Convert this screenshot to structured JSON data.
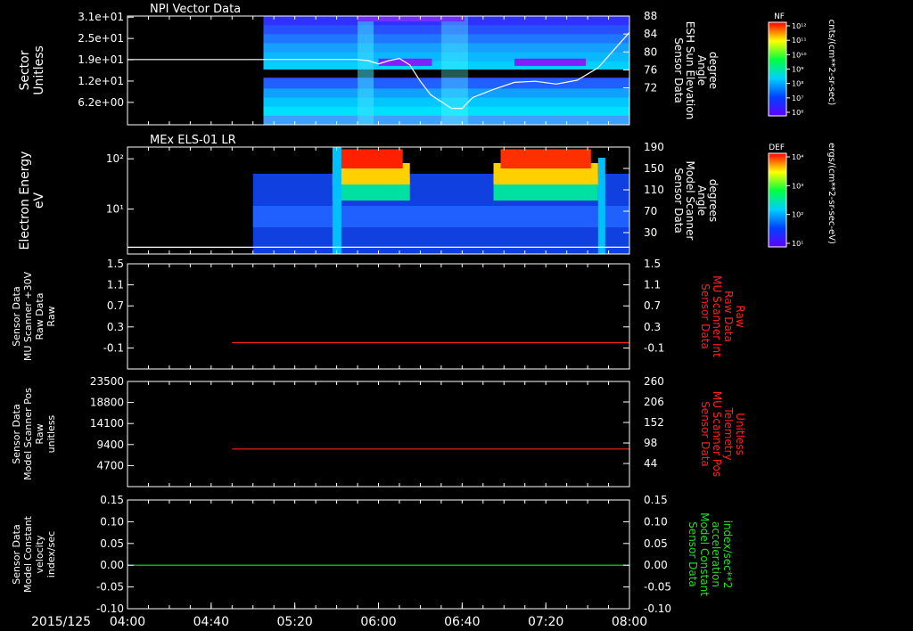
{
  "chart_data": [
    {
      "type": "heatmap",
      "title": "NPI Vector Data",
      "ylabel_lines": [
        "Sector",
        "Unitless"
      ],
      "yticks": [
        "3.1e+01",
        "2.5e+01",
        "1.9e+01",
        "1.2e+01",
        "6.2e+00"
      ],
      "y2label_lines": [
        "Sensor Data",
        "ESH Sun Elevation",
        "Angle",
        "degree"
      ],
      "y2ticks": [
        "88",
        "84",
        "80",
        "76",
        "72"
      ],
      "colorbar_label": "NF",
      "colorbar_units": "cnts/(cm**2-sr-sec)",
      "colorbar_ticks": [
        "10¹²",
        "10¹¹",
        "10¹⁰",
        "10⁹",
        "10⁸",
        "10⁷",
        "10⁶"
      ],
      "overlay_series": {
        "name": "ESH Sun Elevation Angle",
        "color": "#ffffff",
        "x": [
          "04:00",
          "05:20",
          "05:50",
          "05:55",
          "06:00",
          "06:05",
          "06:10",
          "06:15",
          "06:20",
          "06:25",
          "06:35",
          "06:40",
          "06:45",
          "06:55",
          "07:05",
          "07:15",
          "07:25",
          "07:35",
          "07:45",
          "08:00"
        ],
        "y": [
          80.0,
          80.0,
          80.0,
          79.8,
          79.2,
          79.8,
          80.2,
          79.0,
          76.0,
          73.5,
          71.0,
          71.0,
          73.0,
          74.5,
          75.8,
          76.0,
          75.5,
          76.2,
          78.5,
          85.0
        ]
      }
    },
    {
      "type": "heatmap",
      "title": "MEx ELS-01 LR",
      "ylabel_lines": [
        "Electron Energy",
        "eV"
      ],
      "yticks": [
        "10²",
        "10¹"
      ],
      "y2label_lines": [
        "Sensor Data",
        "Model Scanner",
        "Angle",
        "degrees"
      ],
      "y2ticks": [
        "190",
        "150",
        "110",
        "70",
        "30"
      ],
      "colorbar_label": "DEF",
      "colorbar_units": "ergs/(cm**2-sr-sec-eV)",
      "colorbar_ticks": [
        "10⁴",
        "10³",
        "10²",
        "10¹"
      ],
      "overlay_series": {
        "name": "Model Scanner Angle",
        "color": "#ffffff",
        "x": [
          "04:00",
          "08:00"
        ],
        "y": [
          12,
          12
        ]
      }
    },
    {
      "type": "line",
      "ylabel_lines": [
        "Sensor Data",
        "MU Scanner +30V",
        "Raw Data",
        "Raw"
      ],
      "yticks": [
        "1.5",
        "1.1",
        "0.7",
        "0.3",
        "-0.1"
      ],
      "ylim": [
        -0.5,
        1.5
      ],
      "y2label_lines": [
        "Sensor Data",
        "MU Scanner Int",
        "Raw Data",
        "Raw"
      ],
      "y2ticks": [
        "1.5",
        "1.1",
        "0.7",
        "0.3",
        "-0.1"
      ],
      "series": [
        {
          "color": "#ff2020",
          "x": [
            "04:50",
            "08:00"
          ],
          "y": [
            0.0,
            0.0
          ]
        }
      ]
    },
    {
      "type": "line",
      "ylabel_lines": [
        "Sensor Data",
        "Model Scanner Pos",
        "Raw",
        "unitless"
      ],
      "yticks": [
        "23500",
        "18800",
        "14100",
        "9400",
        "4700"
      ],
      "ylim": [
        0,
        23500
      ],
      "y2label_lines": [
        "Sensor Data",
        "MU Scanner Pos",
        "Telemetry",
        "Unitless"
      ],
      "y2ticks": [
        "260",
        "206",
        "152",
        "98",
        "44"
      ],
      "series": [
        {
          "color": "#ff2020",
          "x": [
            "04:50",
            "08:00"
          ],
          "y": [
            8400,
            8400
          ]
        }
      ]
    },
    {
      "type": "line",
      "ylabel_lines": [
        "Sensor Data",
        "Model Constant",
        "velocity",
        "index/sec"
      ],
      "yticks": [
        "0.15",
        "0.10",
        "0.05",
        "0.00",
        "-0.05",
        "-0.10"
      ],
      "ylim": [
        -0.1,
        0.15
      ],
      "y2label_lines": [
        "Sensor Data",
        "Model Constant",
        "acceleration",
        "index/sec**2"
      ],
      "y2ticks": [
        "0.15",
        "0.10",
        "0.05",
        "0.00",
        "-0.05",
        "-0.10"
      ],
      "series": [
        {
          "color": "#20e020",
          "x": [
            "04:00",
            "08:00"
          ],
          "y": [
            0.0,
            0.0
          ]
        }
      ]
    }
  ],
  "time_axis": {
    "date_label": "2015/125",
    "ticks": [
      "04:00",
      "04:40",
      "05:20",
      "06:00",
      "06:40",
      "07:20",
      "08:00"
    ],
    "start": "04:00",
    "end": "08:00"
  },
  "colors": {
    "background": "#000000",
    "axis": "#ffffff",
    "raw_line": "#ff2020",
    "constant_line": "#20e020"
  }
}
